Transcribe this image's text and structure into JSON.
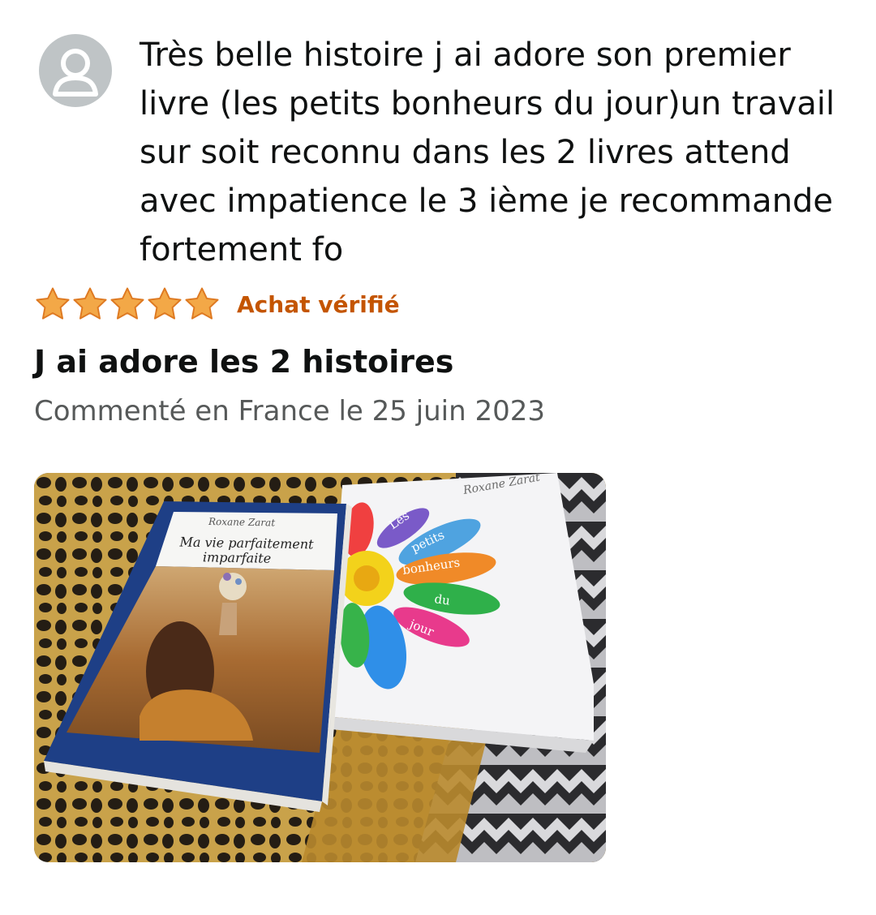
{
  "review": {
    "body": "Très belle histoire j ai adore son premier\nlivre (les petits bonheurs du jour)un travail\nsur soit reconnu dans les 2 livres attend\navec impatience le 3 ième je recommande\nfortement fo",
    "rating": {
      "value": 5,
      "max": 5,
      "star_color": "#f3a847"
    },
    "verified_label": "Achat vérifié",
    "title": "J ai adore les 2 histoires",
    "date_line": "Commenté en France le 25 juin 2023",
    "photo": {
      "book1": {
        "author": "Roxane Zarat",
        "title_line1": "Ma vie parfaitement",
        "title_line2": "imparfaite"
      },
      "book2": {
        "author": "Roxane Zarat",
        "petals": [
          "Les",
          "petits",
          "bonheurs",
          "du",
          "jour"
        ]
      }
    }
  },
  "icons": {
    "avatar": "user-avatar-icon",
    "star": "star-icon"
  }
}
